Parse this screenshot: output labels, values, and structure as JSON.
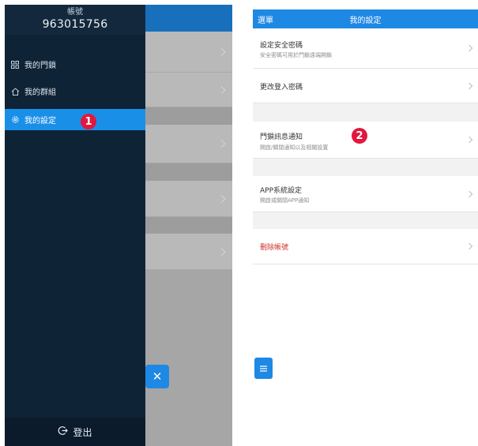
{
  "drawer": {
    "account_label": "帳號",
    "account_id": "963015756",
    "items": [
      {
        "label": "我的門鎖",
        "icon": "grid-icon"
      },
      {
        "label": "我的群組",
        "icon": "home-icon"
      },
      {
        "label": "我的設定",
        "icon": "gear-icon",
        "active": true
      }
    ],
    "logout_label": "登出"
  },
  "annotations": {
    "step1": "1",
    "step2": "2"
  },
  "settings": {
    "header_menu": "選單",
    "header_title": "我的設定",
    "rows": [
      {
        "title": "設定安全密碼",
        "subtitle": "安全密碼可用於門鎖遠端開鎖"
      },
      {
        "title": "更改登入密碼"
      },
      {
        "title": "門鎖訊息通知",
        "subtitle": "開啟/關閉通知以及相關設置"
      },
      {
        "title": "APP系統設定",
        "subtitle": "開啟或關閉APP通知"
      },
      {
        "title": "刪除帳號",
        "danger": true
      }
    ]
  },
  "colors": {
    "accent": "#1e88e5",
    "drawer": "#0f2336",
    "badge": "#e3173e",
    "danger": "#d0312d"
  }
}
